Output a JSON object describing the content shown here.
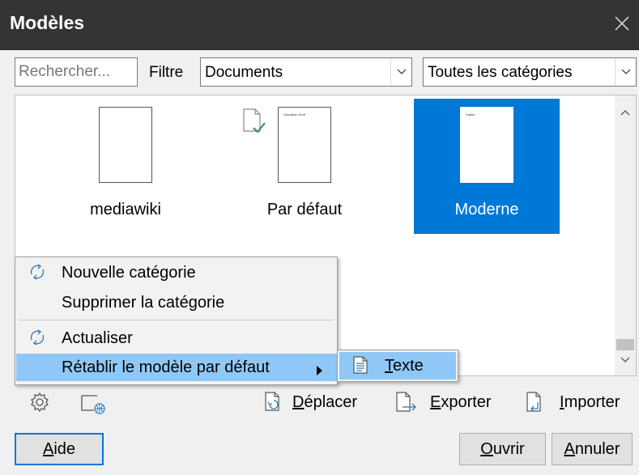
{
  "window": {
    "title": "Modèles"
  },
  "search": {
    "placeholder": "Rechercher..."
  },
  "filter": {
    "label": "Filtre",
    "document_type": "Documents",
    "category": "Toutes les catégories"
  },
  "templates": [
    {
      "name": "mediawiki",
      "preview_text": "",
      "selected": false
    },
    {
      "name": "Par défaut",
      "preview_text": "Liberation Serif",
      "selected": false,
      "is_default": true
    },
    {
      "name": "Moderne",
      "preview_text": "Carlito",
      "selected": true
    }
  ],
  "context_menu": {
    "items": [
      {
        "label": "Nouvelle catégorie",
        "icon": "refresh-icon"
      },
      {
        "label": "Supprimer la catégorie",
        "icon": ""
      },
      {
        "label": "Actualiser",
        "icon": "refresh-icon"
      },
      {
        "label": "Rétablir le modèle par défaut",
        "icon": "",
        "has_submenu": true,
        "highlighted": true
      }
    ],
    "submenu": {
      "first": "T",
      "rest": "exte",
      "icon": "text-document-icon"
    }
  },
  "actions": {
    "move": {
      "first": "D",
      "rest": "éplacer"
    },
    "export": {
      "first": "E",
      "rest": "xporter"
    },
    "import": {
      "first": "I",
      "rest": "mporter"
    }
  },
  "buttons": {
    "help": {
      "first": "A",
      "rest": "ide"
    },
    "open": {
      "first": "O",
      "rest": "uvrir"
    },
    "cancel": {
      "first": "A",
      "rest": "nnuler"
    }
  },
  "colors": {
    "titlebar": "#333333",
    "selection": "#0078d7",
    "menu_highlight": "#8fc8f7"
  }
}
